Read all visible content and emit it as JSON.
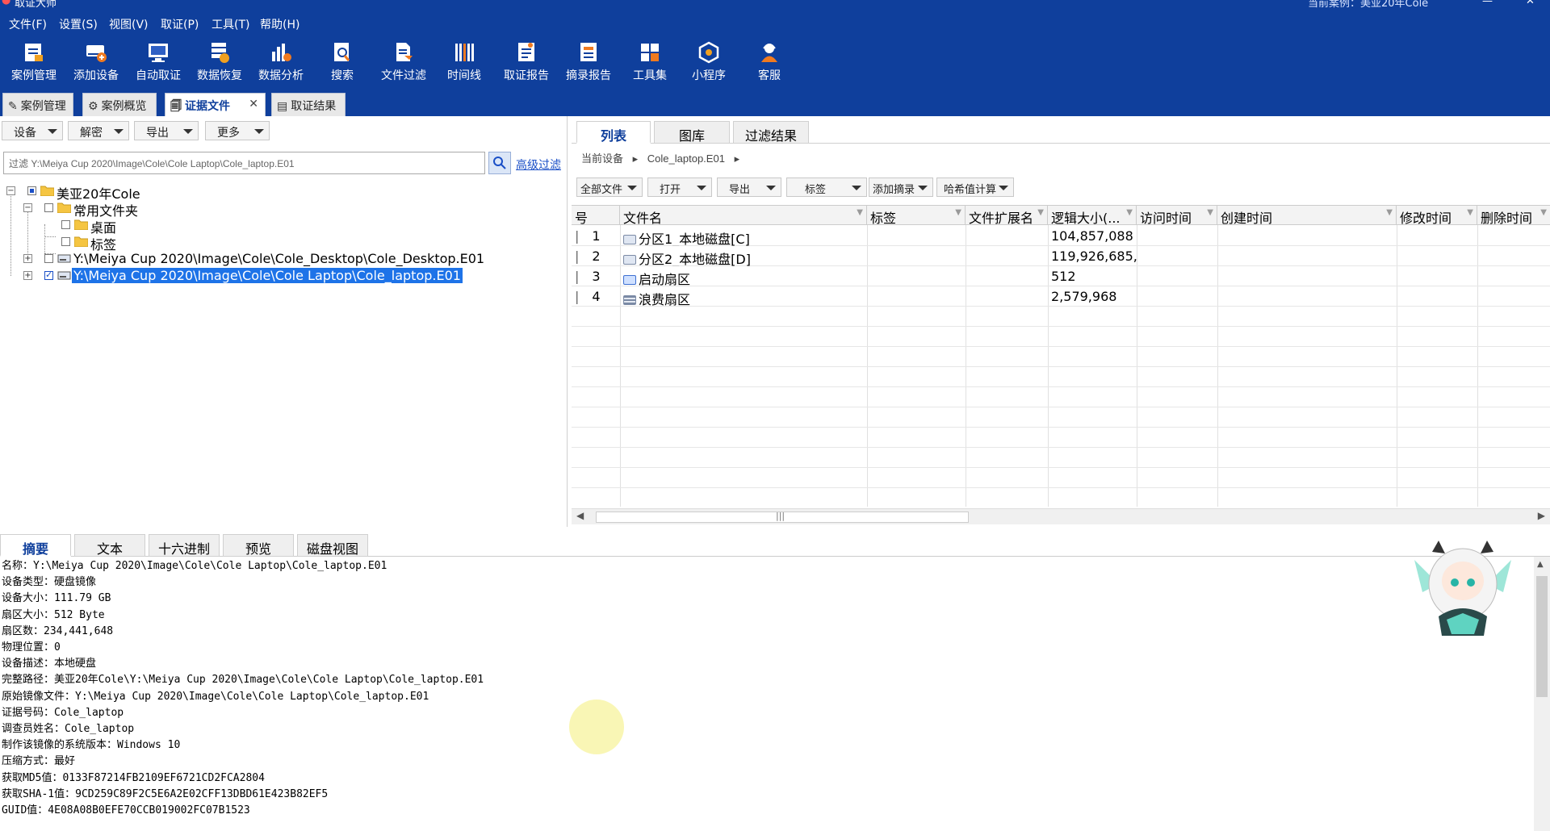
{
  "window": {
    "title": "取证大师",
    "current_case": "当前案例：美亚20年Cole",
    "min": "—",
    "close": "✕"
  },
  "menu": [
    "文件(F)",
    "设置(S)",
    "视图(V)",
    "取证(P)",
    "工具(T)",
    "帮助(H)"
  ],
  "toolbar": [
    {
      "label": "案例管理",
      "icon": "case-manage-icon"
    },
    {
      "label": "添加设备",
      "icon": "add-device-icon"
    },
    {
      "label": "自动取证",
      "icon": "auto-forensic-icon"
    },
    {
      "label": "数据恢复",
      "icon": "data-recovery-icon"
    },
    {
      "label": "数据分析",
      "icon": "data-analysis-icon"
    },
    {
      "label": "搜索",
      "icon": "search-doc-icon"
    },
    {
      "label": "文件过滤",
      "icon": "file-filter-icon"
    },
    {
      "label": "时间线",
      "icon": "timeline-icon"
    },
    {
      "label": "取证报告",
      "icon": "forensic-report-icon"
    },
    {
      "label": "摘录报告",
      "icon": "excerpt-report-icon"
    },
    {
      "label": "工具集",
      "icon": "toolset-icon"
    },
    {
      "label": "小程序",
      "icon": "mini-program-icon"
    },
    {
      "label": "客服",
      "icon": "customer-service-icon"
    }
  ],
  "doc_tabs": [
    {
      "label": "案例管理",
      "active": false
    },
    {
      "label": "案例概览",
      "active": false
    },
    {
      "label": "证据文件",
      "active": true
    },
    {
      "label": "取证结果",
      "active": false
    }
  ],
  "left": {
    "buttons": [
      "设备",
      "解密",
      "导出",
      "更多"
    ],
    "filter_value": "过滤 Y:\\Meiya Cup 2020\\Image\\Cole\\Cole Laptop\\Cole_laptop.E01",
    "advanced_filter": "高级过滤",
    "tree": {
      "root": "美亚20年Cole",
      "common_folder": "常用文件夹",
      "desktop": "桌面",
      "tags": "标签",
      "image1": "Y:\\Meiya Cup 2020\\Image\\Cole\\Cole_Desktop\\Cole_Desktop.E01",
      "image2": "Y:\\Meiya Cup 2020\\Image\\Cole\\Cole Laptop\\Cole_laptop.E01"
    }
  },
  "right": {
    "tabs": [
      "列表",
      "图库",
      "过滤结果"
    ],
    "breadcrumb": [
      "当前设备",
      "Cole_laptop.E01"
    ],
    "buttons": [
      "全部文件",
      "打开",
      "导出",
      "标签",
      "添加摘录",
      "哈希值计算"
    ],
    "columns": [
      "号",
      "文件名",
      "标签",
      "文件扩展名",
      "逻辑大小(...",
      "访问时间",
      "创建时间",
      "修改时间",
      "删除时间"
    ],
    "rows": [
      {
        "num": "1",
        "name": "分区1_本地磁盘[C]",
        "size": "104,857,088",
        "icon": "disk-icon"
      },
      {
        "num": "2",
        "name": "分区2_本地磁盘[D]",
        "size": "119,926,685,...",
        "icon": "disk-icon"
      },
      {
        "num": "3",
        "name": "启动扇区",
        "size": "512",
        "icon": "boot-sector-icon"
      },
      {
        "num": "4",
        "name": "浪费扇区",
        "size": "2,579,968",
        "icon": "wasted-sector-icon"
      }
    ]
  },
  "bottom": {
    "tabs": [
      "摘要",
      "文本",
      "十六进制",
      "预览",
      "磁盘视图"
    ],
    "summary": [
      "名称：Y:\\Meiya Cup 2020\\Image\\Cole\\Cole Laptop\\Cole_laptop.E01",
      "设备类型：硬盘镜像",
      "设备大小：111.79 GB",
      "扇区大小：512 Byte",
      "扇区数：234,441,648",
      "物理位置：0",
      "设备描述：本地硬盘",
      "完整路径：美亚20年Cole\\Y:\\Meiya Cup 2020\\Image\\Cole\\Cole Laptop\\Cole_laptop.E01",
      "原始镜像文件：Y:\\Meiya Cup 2020\\Image\\Cole\\Cole Laptop\\Cole_laptop.E01",
      "证据号码：Cole_laptop",
      "调查员姓名：Cole_laptop",
      "制作该镜像的系统版本：Windows 10",
      "压缩方式：最好",
      "获取MD5值：0133F87214FB2109EF6721CD2FCA2804",
      "获取SHA-1值：9CD259C89F2C5E6A2E02CFF13DBD61E423B82EF5",
      "GUID值：4E08A08B0EFE70CCB019002FC07B1523"
    ]
  },
  "colors": {
    "primary_blue": "#0f3f9c",
    "selection": "#1e73e8",
    "link": "#1a4fc7"
  }
}
